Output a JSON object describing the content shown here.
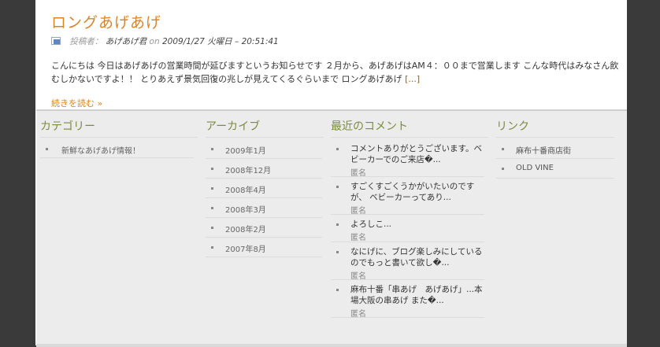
{
  "post": {
    "title": "ロングあげあげ",
    "meta_label": "投稿者：",
    "author": "あげあげ君",
    "on": "on",
    "date": "2009/1/27 火曜日 – 20:51:41",
    "body": "こんにちは 今日はあげあげの営業時間が延びますというお知らせです ２月から、あげあげはAM４：００まで営業します こんな時代はみなさん飲むしかないですよ！！ とりあえず景気回復の兆しが見えてくるぐらいまで ロングあげあげ",
    "body_ellipsis": "[...]",
    "read_more": "続きを読む »"
  },
  "footer": {
    "categories": {
      "title": "カテゴリー",
      "items": [
        "新鮮なあげあげ情報！"
      ]
    },
    "archives": {
      "title": "アーカイブ",
      "items": [
        "2009年1月",
        "2008年12月",
        "2008年4月",
        "2008年3月",
        "2008年2月",
        "2007年8月"
      ]
    },
    "comments": {
      "title": "最近のコメント",
      "items": [
        {
          "text": "コメントありがとうございます。ベビーカーでのご来店�...",
          "author": "匿名"
        },
        {
          "text": "すごくすごくうかがいたいのですが、 ベビーカーってあり...",
          "author": "匿名"
        },
        {
          "text": "よろしこ...",
          "author": "匿名"
        },
        {
          "text": "なにげに、ブログ楽しみにしているのでもっと書いて欲し�...",
          "author": "匿名"
        },
        {
          "text": "麻布十番「串あげ　あげあげ」...本場大阪の串あげ また�...",
          "author": "匿名"
        }
      ]
    },
    "links": {
      "title": "リンク",
      "items": [
        "麻布十番商店街",
        "OLD VINE"
      ]
    }
  },
  "colors": {
    "title_accent": "#d8852a",
    "widget_heading": "#7a8c3e",
    "footer_bg": "#ececec",
    "outer_bg": "#3a3a3a"
  }
}
